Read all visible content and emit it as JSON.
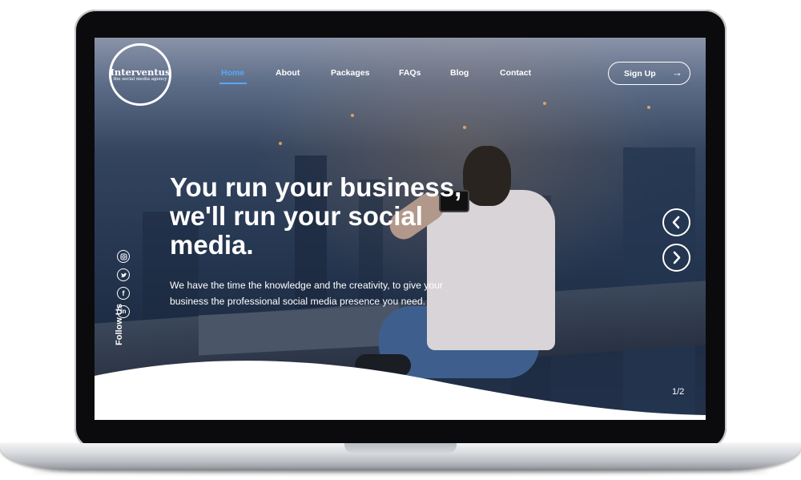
{
  "brand": {
    "name": "Interventus",
    "tagline": "the social media agency"
  },
  "nav": {
    "items": [
      {
        "label": "Home",
        "active": true
      },
      {
        "label": "About",
        "active": false
      },
      {
        "label": "Packages",
        "active": false
      },
      {
        "label": "FAQs",
        "active": false
      },
      {
        "label": "Blog",
        "active": false
      },
      {
        "label": "Contact",
        "active": false
      }
    ],
    "signup_label": "Sign Up",
    "signup_icon": "arrow-right-icon"
  },
  "hero": {
    "title_lines": [
      "You run your business,",
      "we'll run your social",
      "media."
    ],
    "subtitle": "We have the time the knowledge and the creativity, to give your business the professional social media presence you need."
  },
  "social": {
    "icons": [
      "instagram-icon",
      "twitter-icon",
      "facebook-icon",
      "linkedin-icon"
    ],
    "follow_label": "Follow Us"
  },
  "slider": {
    "prev_icon": "chevron-left-icon",
    "next_icon": "chevron-right-icon",
    "counter": "1/2"
  },
  "colors": {
    "accent": "#56a7ff",
    "text": "#ffffff"
  }
}
